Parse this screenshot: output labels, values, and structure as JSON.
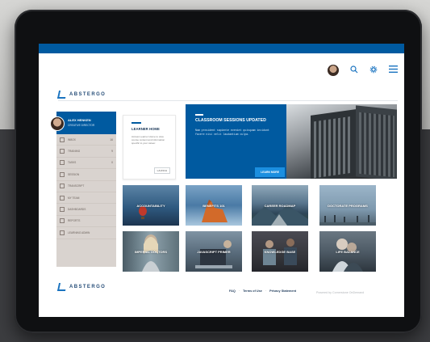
{
  "brand": {
    "name": "ABSTERGO",
    "accent": "#005aa0"
  },
  "header": {
    "icons": [
      "user-avatar",
      "search-icon",
      "gear-icon",
      "menu-icon"
    ]
  },
  "user": {
    "name": "ALEX HENKEN",
    "title": "CREATIVE DIRECTOR"
  },
  "sidebar": {
    "items": [
      {
        "label": "INBOX",
        "count": "16",
        "icon": "inbox-icon"
      },
      {
        "label": "TRAINING",
        "count": "9",
        "icon": "training-icon"
      },
      {
        "label": "TASKS",
        "count": "0",
        "icon": "tasks-icon"
      },
      {
        "label": "SESSION",
        "count": "",
        "icon": "calendar-icon"
      },
      {
        "label": "TRANSCRIPT",
        "count": "",
        "icon": "transcript-icon"
      },
      {
        "label": "MY TEAM",
        "count": "",
        "icon": "team-icon"
      },
      {
        "label": "DASHBOARDS",
        "count": "",
        "icon": "dashboard-icon"
      },
      {
        "label": "REPORTS",
        "count": "",
        "icon": "reports-icon"
      },
      {
        "label": "LEARNING ADMIN",
        "count": "",
        "icon": "admin-icon"
      }
    ]
  },
  "learner_home": {
    "title": "LEARNER HOME",
    "description": "Access Learner Home to view course content and information specific to your career.",
    "button": "LAUNCH"
  },
  "hero": {
    "title": "CLASSROOM SESSIONS UPDATED",
    "description": "Nam provident sapiente eveniet quisquam incidunt facere nisi velit laudantium culpa.",
    "button": "LEARN MORE"
  },
  "tiles": [
    {
      "label": "ACCOUNTABILITY"
    },
    {
      "label": "BENEFITS 101"
    },
    {
      "label": "CAREER ROADMAP"
    },
    {
      "label": "DOCTORATE PROGRAMS"
    },
    {
      "label": "IMPERIAL DOCTORS"
    },
    {
      "label": "JAVASCRIPT PRIMER"
    },
    {
      "label": "KNOWLEDGE BASE"
    },
    {
      "label": "LIFE BALANCE"
    }
  ],
  "footer": {
    "links": [
      "FAQ",
      "Terms of Use",
      "Privacy Statement"
    ],
    "separator": "·",
    "powered_by": "Powered by Cornerstone OnDemand"
  }
}
